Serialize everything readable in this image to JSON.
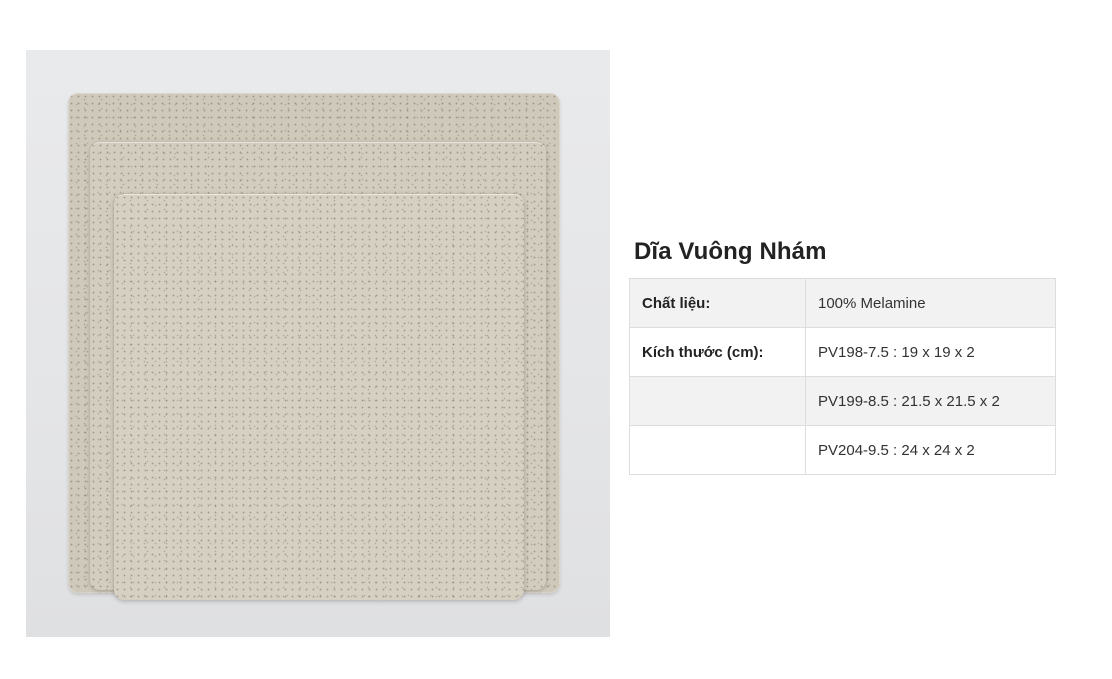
{
  "product": {
    "title": "Dĩa Vuông Nhám",
    "image_subject": "square textured melamine plates"
  },
  "specs": {
    "rows": [
      {
        "label": "Chất liệu:",
        "value": "100% Melamine"
      },
      {
        "label": "Kích thước (cm):",
        "value": "PV198-7.5 : 19 x 19 x 2"
      },
      {
        "label": "",
        "value": "PV199-8.5 : 21.5 x 21.5 x 2"
      },
      {
        "label": "",
        "value": "PV204-9.5 : 24 x 24 x 2"
      }
    ]
  },
  "colors": {
    "plate": "#d3cdbf",
    "photo_background": "#e6e7e9",
    "table_shade": "#f2f2f2",
    "table_border": "#dddddd"
  }
}
